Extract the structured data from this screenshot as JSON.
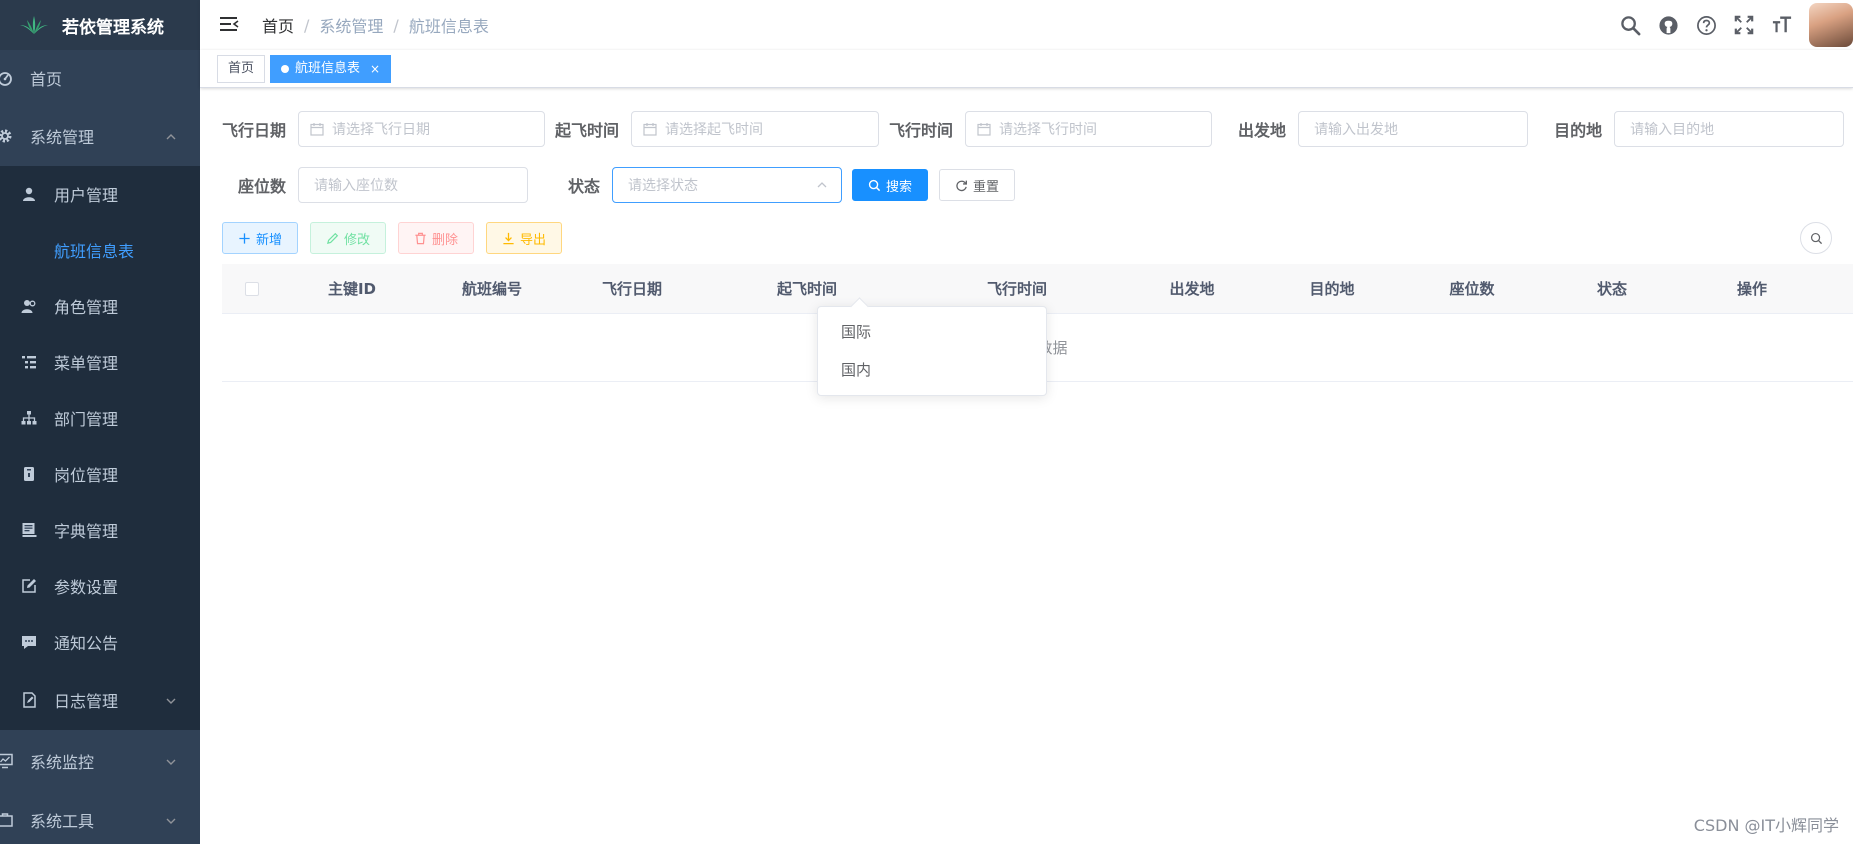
{
  "app": {
    "title": "若依管理系统"
  },
  "sidebar": {
    "items": [
      {
        "label": "首页",
        "icon": "dashboard-icon"
      },
      {
        "label": "系统管理",
        "icon": "gear-icon"
      },
      {
        "label": "用户管理",
        "icon": "user-icon"
      },
      {
        "label": "航班信息表",
        "icon": ""
      },
      {
        "label": "角色管理",
        "icon": "peoples-icon"
      },
      {
        "label": "菜单管理",
        "icon": "tree-table-icon"
      },
      {
        "label": "部门管理",
        "icon": "tree-icon"
      },
      {
        "label": "岗位管理",
        "icon": "post-icon"
      },
      {
        "label": "字典管理",
        "icon": "dict-icon"
      },
      {
        "label": "参数设置",
        "icon": "edit-icon"
      },
      {
        "label": "通知公告",
        "icon": "message-icon"
      },
      {
        "label": "日志管理",
        "icon": "log-icon"
      },
      {
        "label": "系统监控",
        "icon": "monitor-icon"
      },
      {
        "label": "系统工具",
        "icon": "tool-icon"
      }
    ]
  },
  "navbar": {
    "breadcrumb": [
      "首页",
      "系统管理",
      "航班信息表"
    ],
    "separator": "/"
  },
  "tags": {
    "home": "首页",
    "active": "航班信息表",
    "close": "×"
  },
  "search_form": {
    "flight_date": {
      "label": "飞行日期",
      "placeholder": "请选择飞行日期"
    },
    "takeoff_time": {
      "label": "起飞时间",
      "placeholder": "请选择起飞时间"
    },
    "flight_time": {
      "label": "飞行时间",
      "placeholder": "请选择飞行时间"
    },
    "departure": {
      "label": "出发地",
      "placeholder": "请输入出发地"
    },
    "destination": {
      "label": "目的地",
      "placeholder": "请输入目的地"
    },
    "seats": {
      "label": "座位数",
      "placeholder": "请输入座位数"
    },
    "status": {
      "label": "状态",
      "placeholder": "请选择状态"
    },
    "search_button": "搜索",
    "reset_button": "重置"
  },
  "status_options": [
    "国际",
    "国内"
  ],
  "toolbar": {
    "add": "新增",
    "edit": "修改",
    "delete": "删除",
    "export": "导出"
  },
  "table": {
    "columns": [
      "主键ID",
      "航班编号",
      "飞行日期",
      "起飞时间",
      "飞行时间",
      "出发地",
      "目的地",
      "座位数",
      "状态",
      "操作"
    ],
    "empty_text": "暂无数据"
  },
  "watermark": "CSDN @IT小辉同学",
  "colors": {
    "sidebar_bg": "#304156",
    "submenu_bg": "#1f2d3d",
    "primary": "#1890ff",
    "active_menu": "#409eff"
  }
}
